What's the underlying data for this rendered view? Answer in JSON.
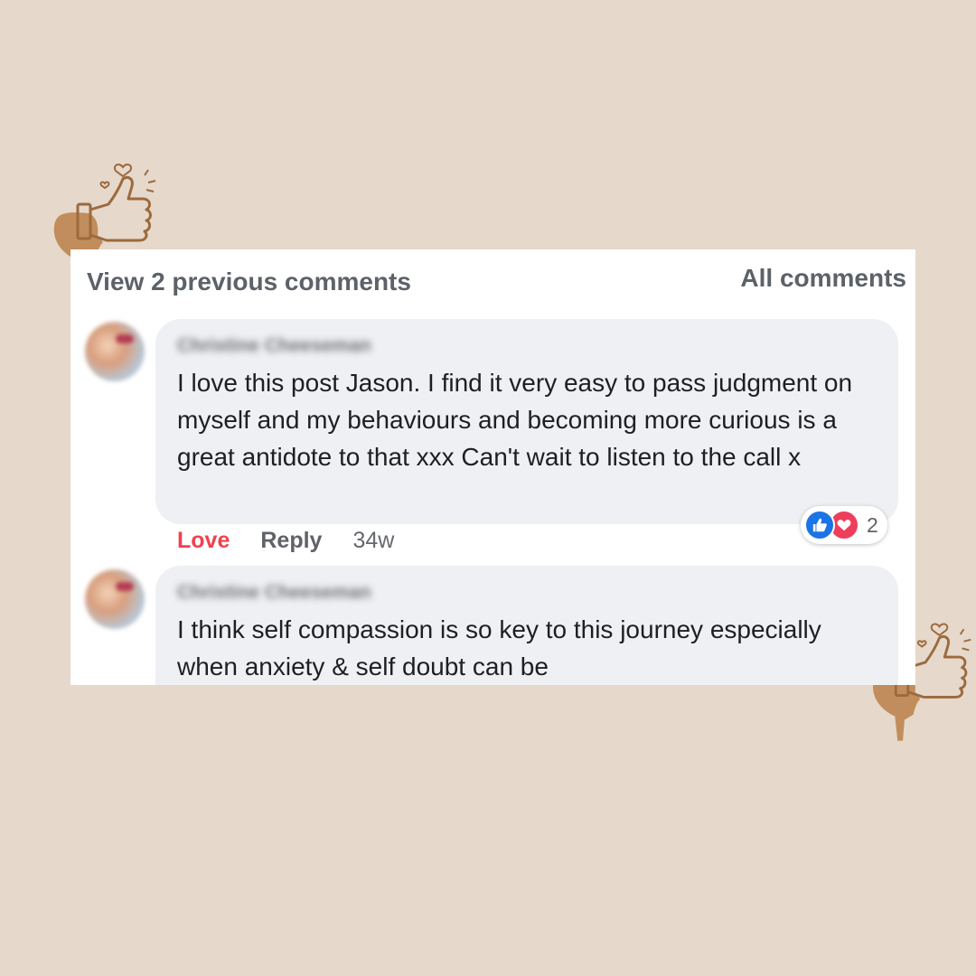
{
  "header": {
    "view_previous_label": "View 2 previous comments",
    "filter_label": "All comments"
  },
  "comments": [
    {
      "author": "Christine Cheeseman",
      "text": "I love this post Jason. I find it very easy to pass judgment on myself and my behaviours and becoming more curious is a great antidote to that xxx Can't wait to listen to the call x",
      "actions": {
        "love_label": "Love",
        "reply_label": "Reply",
        "time": "34w"
      },
      "reactions": {
        "types": [
          "like-icon",
          "love-reaction-icon"
        ],
        "count": "2"
      }
    },
    {
      "author": "Christine Cheeseman",
      "text": "I think self compassion is so key to this journey especially when anxiety & self doubt can be"
    }
  ],
  "colors": {
    "background": "#e6d8ca",
    "love_active": "#f0414f",
    "like_blue": "#1b74e4",
    "heart_red": "#ef3e5b",
    "decoration_brown": "#c28d5c"
  },
  "decorations": [
    "head-thumbs-up-icon",
    "head-thumbs-up-icon"
  ]
}
